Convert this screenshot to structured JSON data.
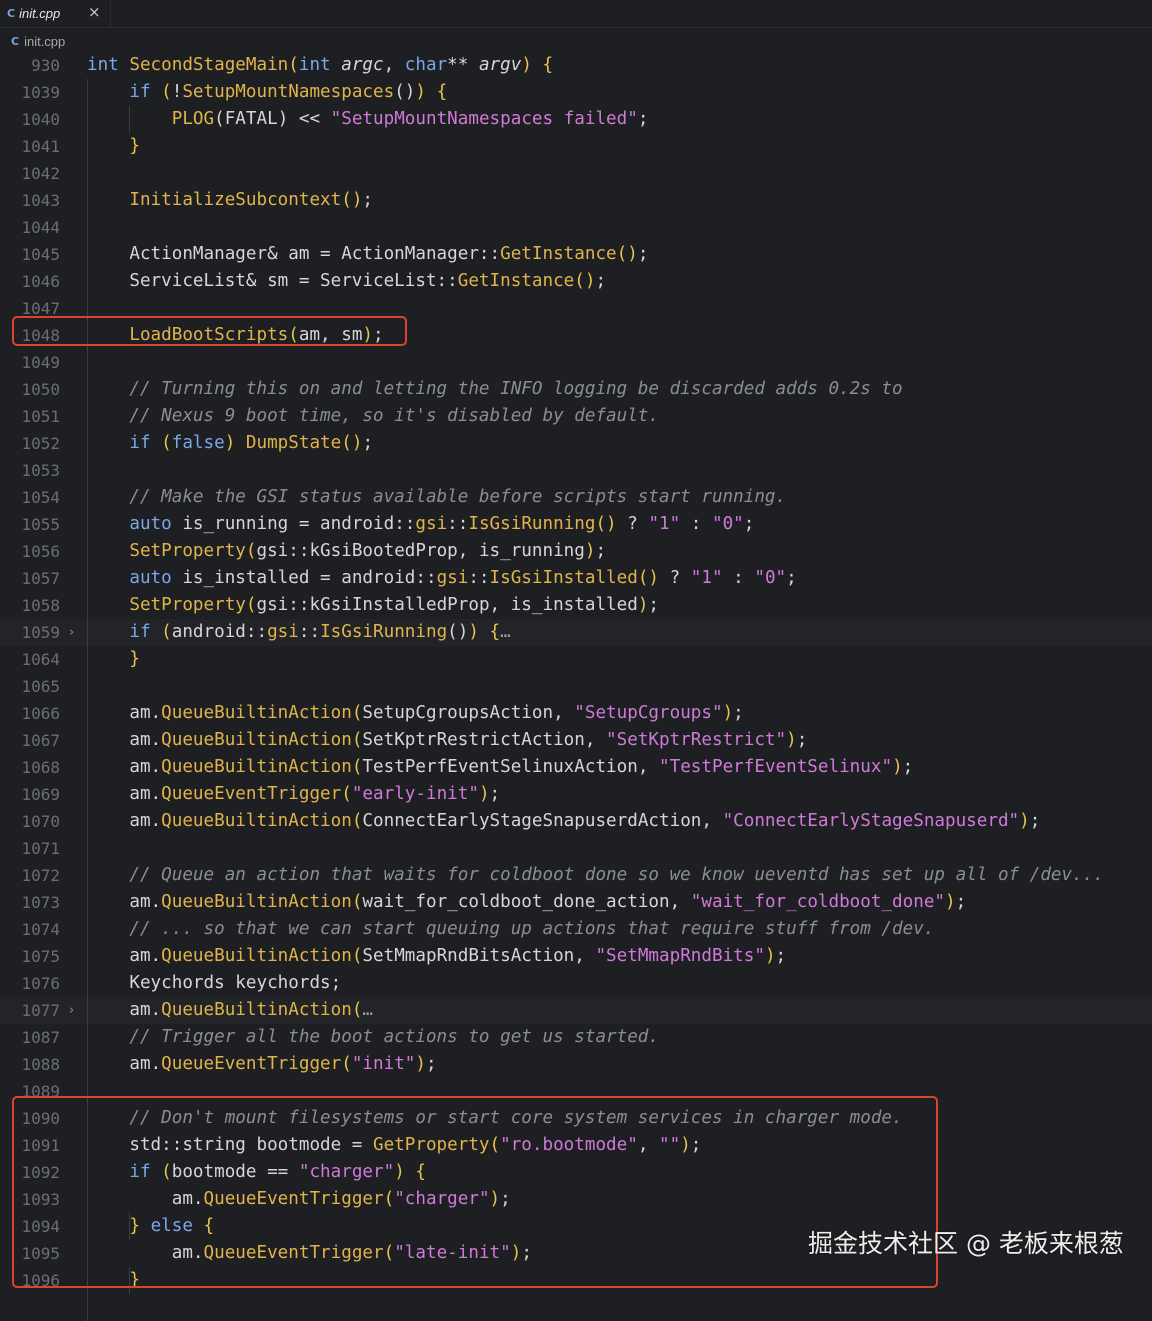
{
  "tab": {
    "icon": "cpp-file-icon",
    "title": "init.cpp",
    "close": "×"
  },
  "breadcrumb": {
    "icon": "cpp-file-icon",
    "file": "init.cpp"
  },
  "colors": {
    "keyword": "#7aa7e6",
    "function": "#e0b44a",
    "string": "#cf7ad8",
    "comment": "#8a8d93",
    "highlight": "#d9442c"
  },
  "lines": [
    {
      "n": "930",
      "tokens": [
        [
          "kw",
          "int "
        ],
        [
          "fn",
          "SecondStageMain"
        ],
        [
          "br",
          "("
        ],
        [
          "kw",
          "int "
        ],
        [
          "pm",
          "argc"
        ],
        [
          "",
          "",
          ""
        ],
        [
          ", "
        ],
        [
          "kw",
          "char"
        ],
        [
          "",
          "** "
        ],
        [
          "pm",
          "argv"
        ],
        [
          "br",
          ")"
        ],
        [
          "",
          " "
        ],
        [
          "br",
          "{"
        ]
      ]
    },
    {
      "n": "1039",
      "tokens": [
        [
          "",
          "    "
        ],
        [
          "kw",
          "if "
        ],
        [
          "br",
          "("
        ],
        [
          "",
          "!"
        ],
        [
          "fn",
          "SetupMountNamespaces"
        ],
        [
          "",
          "()"
        ],
        [
          "br",
          ")"
        ],
        [
          "",
          " "
        ],
        [
          "br",
          "{"
        ]
      ]
    },
    {
      "n": "1040",
      "tokens": [
        [
          "",
          "        "
        ],
        [
          "fn",
          "PLOG"
        ],
        [
          "",
          "("
        ],
        [
          "",
          "FATAL"
        ],
        [
          "",
          ") << "
        ],
        [
          "str",
          "\"SetupMountNamespaces failed\""
        ],
        [
          "",
          ";"
        ]
      ]
    },
    {
      "n": "1041",
      "tokens": [
        [
          "",
          "    "
        ],
        [
          "br",
          "}"
        ]
      ]
    },
    {
      "n": "1042",
      "tokens": []
    },
    {
      "n": "1043",
      "tokens": [
        [
          "",
          "    "
        ],
        [
          "fn",
          "InitializeSubcontext"
        ],
        [
          "br",
          "()"
        ],
        [
          "",
          ";"
        ]
      ]
    },
    {
      "n": "1044",
      "tokens": []
    },
    {
      "n": "1045",
      "tokens": [
        [
          "",
          "    ActionManager& am = ActionManager::"
        ],
        [
          "fn",
          "GetInstance"
        ],
        [
          "br",
          "()"
        ],
        [
          "",
          ";"
        ]
      ]
    },
    {
      "n": "1046",
      "tokens": [
        [
          "",
          "    ServiceList& sm = ServiceList::"
        ],
        [
          "fn",
          "GetInstance"
        ],
        [
          "br",
          "()"
        ],
        [
          "",
          ";"
        ]
      ]
    },
    {
      "n": "1047",
      "tokens": []
    },
    {
      "n": "1048",
      "tokens": [
        [
          "",
          "    "
        ],
        [
          "fn",
          "LoadBootScripts"
        ],
        [
          "br",
          "("
        ],
        [
          "",
          "am, sm"
        ],
        [
          "br",
          ")"
        ],
        [
          "",
          ";"
        ]
      ]
    },
    {
      "n": "1049",
      "tokens": []
    },
    {
      "n": "1050",
      "tokens": [
        [
          "",
          "    "
        ],
        [
          "cm",
          "// Turning this on and letting the INFO logging be discarded adds 0.2s to"
        ]
      ]
    },
    {
      "n": "1051",
      "tokens": [
        [
          "",
          "    "
        ],
        [
          "cm",
          "// Nexus 9 boot time, so it's disabled by default."
        ]
      ]
    },
    {
      "n": "1052",
      "tokens": [
        [
          "",
          "    "
        ],
        [
          "kw",
          "if "
        ],
        [
          "br",
          "("
        ],
        [
          "kw",
          "false"
        ],
        [
          "br",
          ")"
        ],
        [
          "",
          " "
        ],
        [
          "fn",
          "DumpState"
        ],
        [
          "br",
          "()"
        ],
        [
          "",
          ";"
        ]
      ]
    },
    {
      "n": "1053",
      "tokens": []
    },
    {
      "n": "1054",
      "tokens": [
        [
          "",
          "    "
        ],
        [
          "cm",
          "// Make the GSI status available before scripts start running."
        ]
      ]
    },
    {
      "n": "1055",
      "tokens": [
        [
          "",
          "    "
        ],
        [
          "kw",
          "auto "
        ],
        [
          "",
          "is_running = android::"
        ],
        [
          "fn",
          "gsi"
        ],
        [
          "",
          "::"
        ],
        [
          "fn",
          "IsGsiRunning"
        ],
        [
          "br",
          "()"
        ],
        [
          "",
          " ? "
        ],
        [
          "str",
          "\"1\""
        ],
        [
          "",
          " : "
        ],
        [
          "str",
          "\"0\""
        ],
        [
          "",
          ";"
        ]
      ]
    },
    {
      "n": "1056",
      "tokens": [
        [
          "",
          "    "
        ],
        [
          "fn",
          "SetProperty"
        ],
        [
          "br",
          "("
        ],
        [
          "",
          "gsi::kGsiBootedProp, is_running"
        ],
        [
          "br",
          ")"
        ],
        [
          "",
          ";"
        ]
      ]
    },
    {
      "n": "1057",
      "tokens": [
        [
          "",
          "    "
        ],
        [
          "kw",
          "auto "
        ],
        [
          "",
          "is_installed = android::"
        ],
        [
          "fn",
          "gsi"
        ],
        [
          "",
          "::"
        ],
        [
          "fn",
          "IsGsiInstalled"
        ],
        [
          "br",
          "()"
        ],
        [
          "",
          " ? "
        ],
        [
          "str",
          "\"1\""
        ],
        [
          "",
          " : "
        ],
        [
          "str",
          "\"0\""
        ],
        [
          "",
          ";"
        ]
      ]
    },
    {
      "n": "1058",
      "tokens": [
        [
          "",
          "    "
        ],
        [
          "fn",
          "SetProperty"
        ],
        [
          "br",
          "("
        ],
        [
          "",
          "gsi::kGsiInstalledProp, is_installed"
        ],
        [
          "br",
          ")"
        ],
        [
          "",
          ";"
        ]
      ]
    },
    {
      "n": "1059",
      "fold": true,
      "tokens": [
        [
          "",
          "    "
        ],
        [
          "kw",
          "if "
        ],
        [
          "br",
          "("
        ],
        [
          "",
          "android::"
        ],
        [
          "fn",
          "gsi"
        ],
        [
          "",
          "::"
        ],
        [
          "fn",
          "IsGsiRunning"
        ],
        [
          "",
          "()"
        ],
        [
          "br",
          ")"
        ],
        [
          "",
          " "
        ],
        [
          "br",
          "{"
        ],
        [
          "ell",
          "…"
        ]
      ]
    },
    {
      "n": "1064",
      "tokens": [
        [
          "",
          "    "
        ],
        [
          "br",
          "}"
        ]
      ]
    },
    {
      "n": "1065",
      "tokens": []
    },
    {
      "n": "1066",
      "tokens": [
        [
          "",
          "    am."
        ],
        [
          "fn",
          "QueueBuiltinAction"
        ],
        [
          "br",
          "("
        ],
        [
          "",
          "SetupCgroupsAction, "
        ],
        [
          "str",
          "\"SetupCgroups\""
        ],
        [
          "br",
          ")"
        ],
        [
          "",
          ";"
        ]
      ]
    },
    {
      "n": "1067",
      "tokens": [
        [
          "",
          "    am."
        ],
        [
          "fn",
          "QueueBuiltinAction"
        ],
        [
          "br",
          "("
        ],
        [
          "",
          "SetKptrRestrictAction, "
        ],
        [
          "str",
          "\"SetKptrRestrict\""
        ],
        [
          "br",
          ")"
        ],
        [
          "",
          ";"
        ]
      ]
    },
    {
      "n": "1068",
      "tokens": [
        [
          "",
          "    am."
        ],
        [
          "fn",
          "QueueBuiltinAction"
        ],
        [
          "br",
          "("
        ],
        [
          "",
          "TestPerfEventSelinuxAction, "
        ],
        [
          "str",
          "\"TestPerfEventSelinux\""
        ],
        [
          "br",
          ")"
        ],
        [
          "",
          ";"
        ]
      ]
    },
    {
      "n": "1069",
      "tokens": [
        [
          "",
          "    am."
        ],
        [
          "fn",
          "QueueEventTrigger"
        ],
        [
          "br",
          "("
        ],
        [
          "str",
          "\"early-init\""
        ],
        [
          "br",
          ")"
        ],
        [
          "",
          ";"
        ]
      ]
    },
    {
      "n": "1070",
      "tokens": [
        [
          "",
          "    am."
        ],
        [
          "fn",
          "QueueBuiltinAction"
        ],
        [
          "br",
          "("
        ],
        [
          "",
          "ConnectEarlyStageSnapuserdAction, "
        ],
        [
          "str",
          "\"ConnectEarlyStageSnapuserd\""
        ],
        [
          "br",
          ")"
        ],
        [
          "",
          ";"
        ]
      ]
    },
    {
      "n": "1071",
      "tokens": []
    },
    {
      "n": "1072",
      "tokens": [
        [
          "",
          "    "
        ],
        [
          "cm",
          "// Queue an action that waits for coldboot done so we know ueventd has set up all of /dev..."
        ]
      ]
    },
    {
      "n": "1073",
      "tokens": [
        [
          "",
          "    am."
        ],
        [
          "fn",
          "QueueBuiltinAction"
        ],
        [
          "br",
          "("
        ],
        [
          "",
          "wait_for_coldboot_done_action, "
        ],
        [
          "str",
          "\"wait_for_coldboot_done\""
        ],
        [
          "br",
          ")"
        ],
        [
          "",
          ";"
        ]
      ]
    },
    {
      "n": "1074",
      "tokens": [
        [
          "",
          "    "
        ],
        [
          "cm",
          "// ... so that we can start queuing up actions that require stuff from /dev."
        ]
      ]
    },
    {
      "n": "1075",
      "tokens": [
        [
          "",
          "    am."
        ],
        [
          "fn",
          "QueueBuiltinAction"
        ],
        [
          "br",
          "("
        ],
        [
          "",
          "SetMmapRndBitsAction, "
        ],
        [
          "str",
          "\"SetMmapRndBits\""
        ],
        [
          "br",
          ")"
        ],
        [
          "",
          ";"
        ]
      ]
    },
    {
      "n": "1076",
      "tokens": [
        [
          "",
          "    Keychords keychords;"
        ]
      ]
    },
    {
      "n": "1077",
      "fold": true,
      "tokens": [
        [
          "",
          "    am."
        ],
        [
          "fn",
          "QueueBuiltinAction"
        ],
        [
          "br",
          "("
        ],
        [
          "ell",
          "…"
        ]
      ]
    },
    {
      "n": "1087",
      "tokens": [
        [
          "",
          "    "
        ],
        [
          "cm",
          "// Trigger all the boot actions to get us started."
        ]
      ]
    },
    {
      "n": "1088",
      "tokens": [
        [
          "",
          "    am."
        ],
        [
          "fn",
          "QueueEventTrigger"
        ],
        [
          "br",
          "("
        ],
        [
          "str",
          "\"init\""
        ],
        [
          "br",
          ")"
        ],
        [
          "",
          ";"
        ]
      ]
    },
    {
      "n": "1089",
      "tokens": []
    },
    {
      "n": "1090",
      "tokens": [
        [
          "",
          "    "
        ],
        [
          "cm",
          "// Don't mount filesystems or start core system services in charger mode."
        ]
      ]
    },
    {
      "n": "1091",
      "tokens": [
        [
          "",
          "    std::string bootmode = "
        ],
        [
          "fn",
          "GetProperty"
        ],
        [
          "br",
          "("
        ],
        [
          "str",
          "\"ro.bootmode\""
        ],
        [
          "",
          ", "
        ],
        [
          "str",
          "\"\""
        ],
        [
          "br",
          ")"
        ],
        [
          "",
          ";"
        ]
      ]
    },
    {
      "n": "1092",
      "tokens": [
        [
          "",
          "    "
        ],
        [
          "kw",
          "if "
        ],
        [
          "br",
          "("
        ],
        [
          "",
          "bootmode == "
        ],
        [
          "str",
          "\"charger\""
        ],
        [
          "br",
          ")"
        ],
        [
          "",
          " "
        ],
        [
          "br",
          "{"
        ]
      ]
    },
    {
      "n": "1093",
      "tokens": [
        [
          "",
          "        am."
        ],
        [
          "fn",
          "QueueEventTrigger"
        ],
        [
          "br",
          "("
        ],
        [
          "str",
          "\"charger\""
        ],
        [
          "br",
          ")"
        ],
        [
          "",
          ";"
        ]
      ]
    },
    {
      "n": "1094",
      "tokens": [
        [
          "",
          "    "
        ],
        [
          "br",
          "}"
        ],
        [
          "",
          " "
        ],
        [
          "kw",
          "else "
        ],
        [
          "br",
          "{"
        ]
      ]
    },
    {
      "n": "1095",
      "tokens": [
        [
          "",
          "        am."
        ],
        [
          "fn",
          "QueueEventTrigger"
        ],
        [
          "br",
          "("
        ],
        [
          "str",
          "\"late-init\""
        ],
        [
          "br",
          ")"
        ],
        [
          "",
          ";"
        ]
      ]
    },
    {
      "n": "1096",
      "tokens": [
        [
          "",
          "    "
        ],
        [
          "br",
          "}"
        ]
      ]
    }
  ],
  "watermark": "掘金技术社区 @ 老板来根葱"
}
